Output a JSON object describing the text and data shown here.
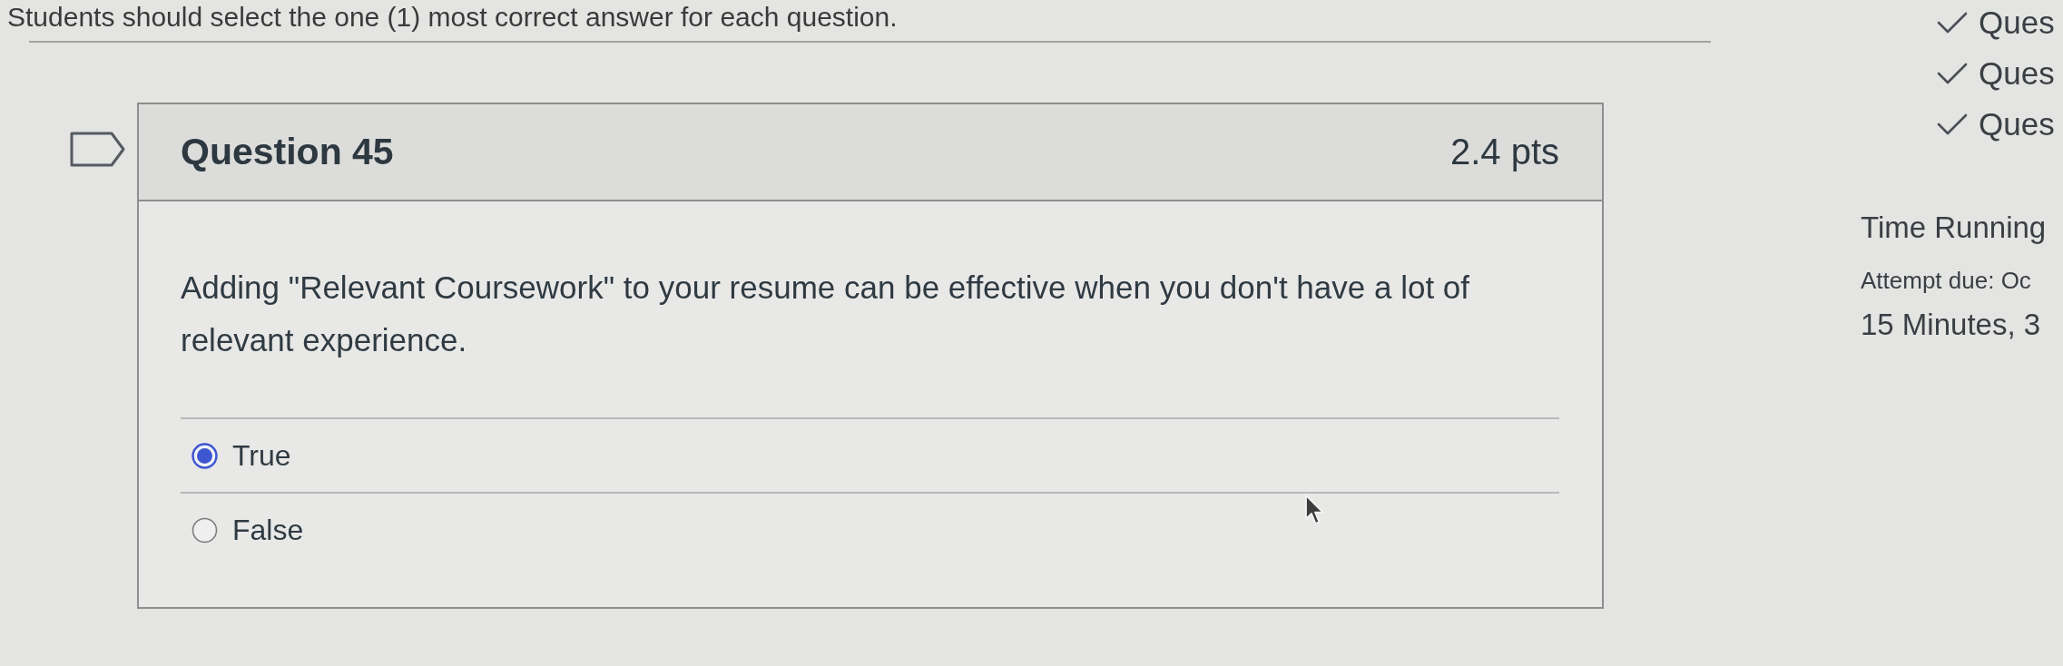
{
  "instructions": "Students should select the one (1) most correct answer for each question.",
  "question": {
    "flagged": false,
    "title": "Question 45",
    "points": "2.4 pts",
    "text": "Adding \"Relevant Coursework\" to your resume can be effective when you don't have a lot of relevant experience.",
    "answers": [
      {
        "label": "True",
        "selected": true
      },
      {
        "label": "False",
        "selected": false
      }
    ]
  },
  "sidebar": {
    "questions": [
      {
        "label": "Ques",
        "answered": true
      },
      {
        "label": "Ques",
        "answered": true
      },
      {
        "label": "Ques",
        "answered": true
      }
    ],
    "timer": {
      "title": "Time Running",
      "due": "Attempt due: Oc",
      "elapsed": "15 Minutes, 3"
    }
  }
}
